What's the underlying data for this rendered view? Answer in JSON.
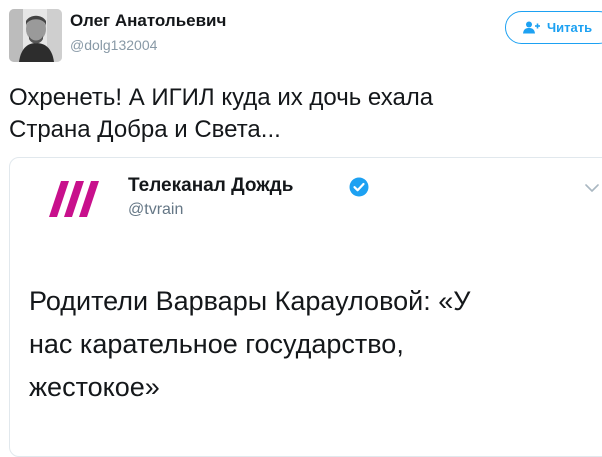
{
  "tweet": {
    "author_name": "Олег Анатольевич",
    "author_handle": "@dolg132004",
    "follow_label": "Читать",
    "text": "Охренеть! А ИГИЛ куда их дочь ехала\nСтрана Добра и Света..."
  },
  "quoted_tweet": {
    "author_name": "Телеканал Дождь",
    "author_handle": "@tvrain",
    "verified": true,
    "text": "Родители Варвары Карауловой: «У\nнас карательное государство,\nжестокое»"
  },
  "colors": {
    "accent": "#1da1f2",
    "brand_logo": "#c8108c",
    "secondary_text": "#8899a6"
  },
  "icons": [
    "avatar",
    "add-user-icon",
    "tvrain-logo",
    "verified-badge-icon",
    "chevron-down-icon"
  ]
}
